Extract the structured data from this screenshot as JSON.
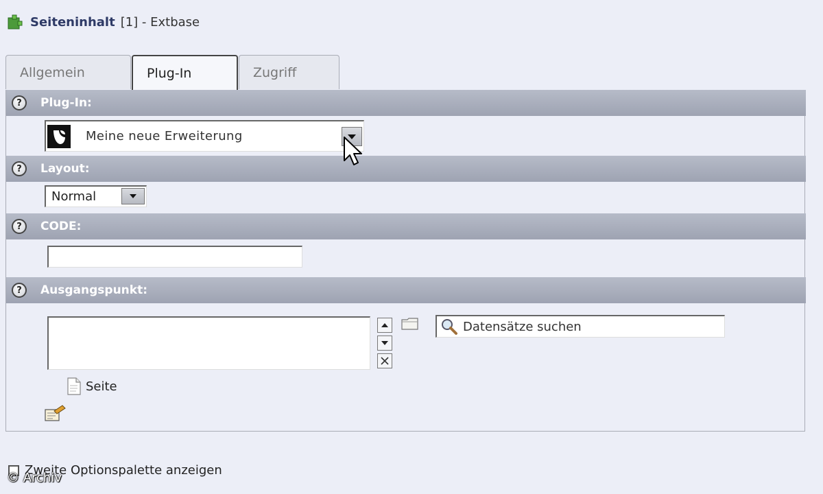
{
  "header": {
    "title_bold": "Seiteninhalt",
    "title_rest": "[1] - Extbase",
    "icon": "plugin-icon"
  },
  "tabs": [
    {
      "label": "Allgemein",
      "active": false
    },
    {
      "label": "Plug-In",
      "active": true
    },
    {
      "label": "Zugriff",
      "active": false
    }
  ],
  "sections": {
    "plugin": {
      "label": "Plug-In:",
      "selected": "Meine neue Erweiterung",
      "icon": "typo3-icon"
    },
    "layout": {
      "label": "Layout:",
      "selected": "Normal"
    },
    "code": {
      "label": "CODE:",
      "value": ""
    },
    "ausgangspunkt": {
      "label": "Ausgangspunkt:",
      "search_text": "Datensätze suchen",
      "record_type": "Seite"
    }
  },
  "bottom": {
    "checkbox_label": "Zweite Optionspalette anzeigen",
    "checked": false
  },
  "watermark": "© Archiv",
  "colors": {
    "background": "#eceef7",
    "section_bar": "#a9aebc",
    "accent_text": "#2e3a66"
  }
}
